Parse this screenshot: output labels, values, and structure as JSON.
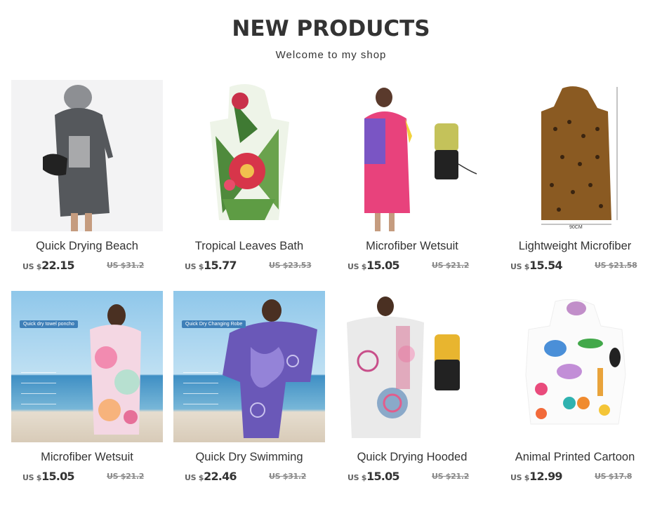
{
  "header": {
    "title": "NEW PRODUCTS",
    "subtitle": "Welcome to my shop"
  },
  "products": [
    {
      "name": "Quick Drying Beach",
      "currency": "US $",
      "price": "22.15",
      "old_price": "US $31.2",
      "image": "grey-hooded-poncho"
    },
    {
      "name": "Tropical Leaves Bath",
      "currency": "US $",
      "price": "15.77",
      "old_price": "US $23.53",
      "image": "tropical-leaves-poncho"
    },
    {
      "name": "Microfiber Wetsuit",
      "currency": "US $",
      "price": "15.05",
      "old_price": "US $21.2",
      "image": "pink-purple-poncho-with-bag"
    },
    {
      "name": "Lightweight Microfiber",
      "currency": "US $",
      "price": "15.54",
      "old_price": "US $21.58",
      "image": "leopard-print-poncho"
    },
    {
      "name": "Microfiber Wetsuit",
      "currency": "US $",
      "price": "15.05",
      "old_price": "US $21.2",
      "image": "floral-poncho-beach",
      "tag": "Quick dry towel poncho"
    },
    {
      "name": "Quick Dry Swimming",
      "currency": "US $",
      "price": "22.46",
      "old_price": "US $31.2",
      "image": "purple-swirl-poncho-beach",
      "tag": "Quick Dry Changing Robe"
    },
    {
      "name": "Quick Drying Hooded",
      "currency": "US $",
      "price": "15.05",
      "old_price": "US $21.2",
      "image": "circles-poncho-with-bag"
    },
    {
      "name": "Animal Printed Cartoon",
      "currency": "US $",
      "price": "12.99",
      "old_price": "US $17.8",
      "image": "animal-cartoon-poncho"
    }
  ],
  "colors": {
    "text": "#333333",
    "old_price": "#888888",
    "tag_bg": "#3e7fb8"
  }
}
